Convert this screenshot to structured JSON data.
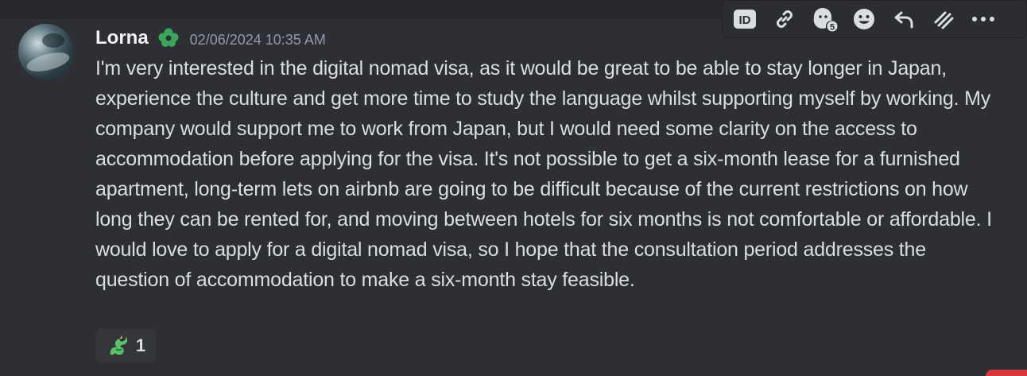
{
  "message": {
    "author": "Lorna",
    "timestamp": "02/06/2024 10:35 AM",
    "text": "I'm very interested in the digital nomad visa, as it would be great to be able to stay longer in Japan, experience the culture and get more time to study the language whilst supporting myself by working. My company would support me to work from Japan, but I would need some clarity on the access to accommodation before applying for the visa. It's not possible to get a six-month lease for a furnished apartment, long-term lets on airbnb are going to be difficult because of the current restrictions on how long they can be rented for, and moving between hotels for six months is not comfortable or affordable. I would love to apply for a digital nomad visa, so I hope that the consultation period addresses the question of accommodation to make a six-month stay feasible.",
    "role_icon": "green-flower-role-icon",
    "role_color": "#3ba55c"
  },
  "reactions": [
    {
      "emoji": "dragon-emoji",
      "count": "1"
    }
  ],
  "toolbar": {
    "items": [
      {
        "icon": "id-icon"
      },
      {
        "icon": "link-icon"
      },
      {
        "icon": "add-reaction-super-icon",
        "badge": "5"
      },
      {
        "icon": "emoji-icon"
      },
      {
        "icon": "reply-icon"
      },
      {
        "icon": "thread-icon"
      },
      {
        "icon": "more-icon"
      }
    ]
  },
  "colors": {
    "background": "#2e2f34",
    "text": "#dbdee1",
    "muted": "#949ba4",
    "toolbar": "#2b2d31"
  }
}
